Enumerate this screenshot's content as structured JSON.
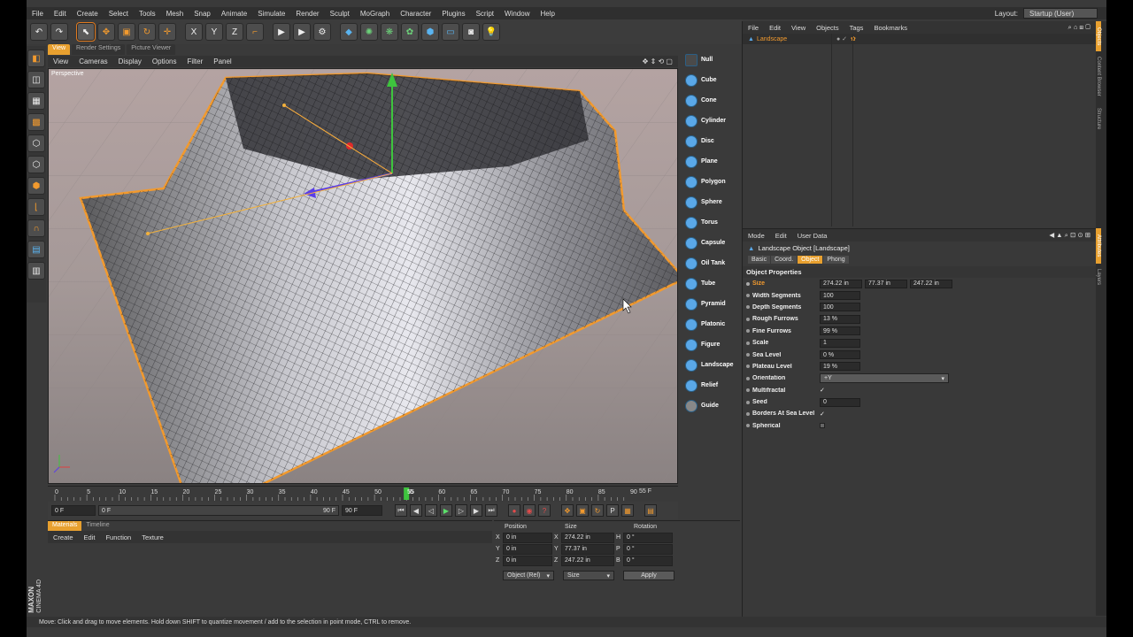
{
  "menubar": {
    "items": [
      "File",
      "Edit",
      "Create",
      "Select",
      "Tools",
      "Mesh",
      "Snap",
      "Animate",
      "Simulate",
      "Render",
      "Sculpt",
      "MoGraph",
      "Character",
      "Plugins",
      "Script",
      "Window",
      "Help"
    ],
    "layout_label": "Layout:",
    "layout_value": "Startup (User)"
  },
  "toolbar": {
    "axis_x": "X",
    "axis_y": "Y",
    "axis_z": "Z"
  },
  "viewport": {
    "tabs": [
      "View",
      "Render Settings",
      "Picture Viewer"
    ],
    "menu": [
      "View",
      "Cameras",
      "Display",
      "Options",
      "Filter",
      "Panel"
    ],
    "label": "Perspective"
  },
  "object_palette": {
    "items": [
      "Null",
      "Cube",
      "Cone",
      "Cylinder",
      "Disc",
      "Plane",
      "Polygon",
      "Sphere",
      "Torus",
      "Capsule",
      "Oil Tank",
      "Tube",
      "Pyramid",
      "Platonic",
      "Figure",
      "Landscape",
      "Relief",
      "Guide"
    ]
  },
  "timeline": {
    "ticks": [
      "0",
      "5",
      "10",
      "15",
      "20",
      "25",
      "30",
      "35",
      "40",
      "45",
      "50",
      "55",
      "60",
      "65",
      "70",
      "75",
      "80",
      "85",
      "90"
    ],
    "current_frame": "55",
    "end_label": "55 F",
    "start_field": "0 F",
    "range_start": "0 F",
    "range_end": "90 F",
    "end_field": "90 F",
    "current_fraction": 0.611
  },
  "materials": {
    "tabs": [
      "Materials",
      "Timeline"
    ],
    "menu": [
      "Create",
      "Edit",
      "Function",
      "Texture"
    ]
  },
  "coordinates": {
    "headers": [
      "Position",
      "Size",
      "Rotation"
    ],
    "rows": [
      {
        "axis": "X",
        "pos": "0 in",
        "saxis": "X",
        "size": "274.22 in",
        "raxis": "H",
        "rot": "0 °"
      },
      {
        "axis": "Y",
        "pos": "0 in",
        "saxis": "Y",
        "size": "77.37 in",
        "raxis": "P",
        "rot": "0 °"
      },
      {
        "axis": "Z",
        "pos": "0 in",
        "saxis": "Z",
        "size": "247.22 in",
        "raxis": "B",
        "rot": "0 °"
      }
    ],
    "mode_dropdown": "Object (Rel)",
    "size_dropdown": "Size",
    "apply_label": "Apply"
  },
  "object_manager": {
    "menu": [
      "File",
      "Edit",
      "View",
      "Objects",
      "Tags",
      "Bookmarks"
    ],
    "object_name": "Landscape"
  },
  "attribute_manager": {
    "menu": [
      "Mode",
      "Edit",
      "User Data"
    ],
    "title": "Landscape Object [Landscape]",
    "tabs": [
      "Basic",
      "Coord.",
      "Object",
      "Phong"
    ],
    "section": "Object Properties",
    "size_label": "Size",
    "size_values": [
      "274.22 in",
      "77.37 in",
      "247.22 in"
    ],
    "params": [
      {
        "label": "Width Segments",
        "value": "100"
      },
      {
        "label": "Depth Segments",
        "value": "100"
      },
      {
        "label": "Rough Furrows",
        "value": "13 %"
      },
      {
        "label": "Fine Furrows",
        "value": "99 %"
      },
      {
        "label": "Scale",
        "value": "1"
      },
      {
        "label": "Sea Level",
        "value": "0 %"
      },
      {
        "label": "Plateau Level",
        "value": "19 %"
      }
    ],
    "orientation_label": "Orientation",
    "orientation_value": "+Y",
    "multifractal_label": "Multifractal",
    "seed_label": "Seed",
    "seed_value": "0",
    "borders_label": "Borders At Sea Level",
    "spherical_label": "Spherical",
    "check": "✓"
  },
  "right_tabs": [
    "Objects",
    "Content Browser",
    "Structure",
    "Attributes",
    "Layers"
  ],
  "branding": {
    "maxon": "MAXON",
    "cinema": "CINEMA 4D"
  },
  "status": "Move: Click and drag to move elements. Hold down SHIFT to quantize movement / add to the selection in point mode, CTRL to remove."
}
